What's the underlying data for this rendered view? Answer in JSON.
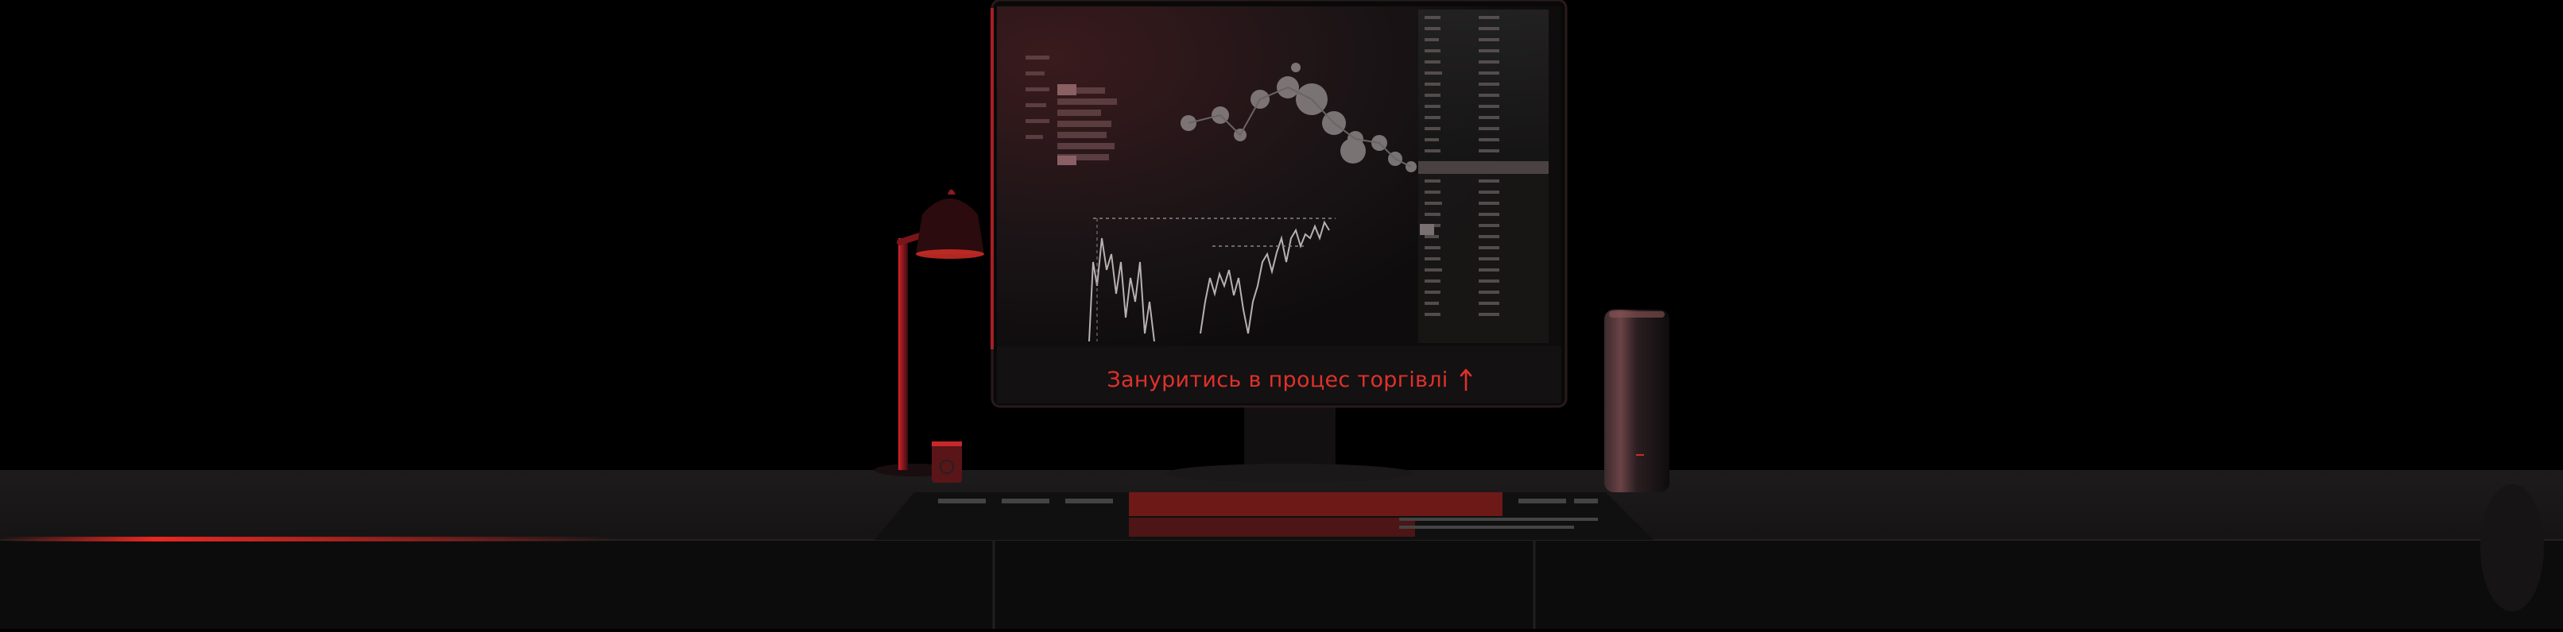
{
  "cta": {
    "label": "Зануритись в процес торгівлі",
    "icon": "arrow-up-icon"
  },
  "colors": {
    "background": "#000000",
    "accent": "#e0312b",
    "desk": "#141213",
    "screen": "#1a1214"
  }
}
